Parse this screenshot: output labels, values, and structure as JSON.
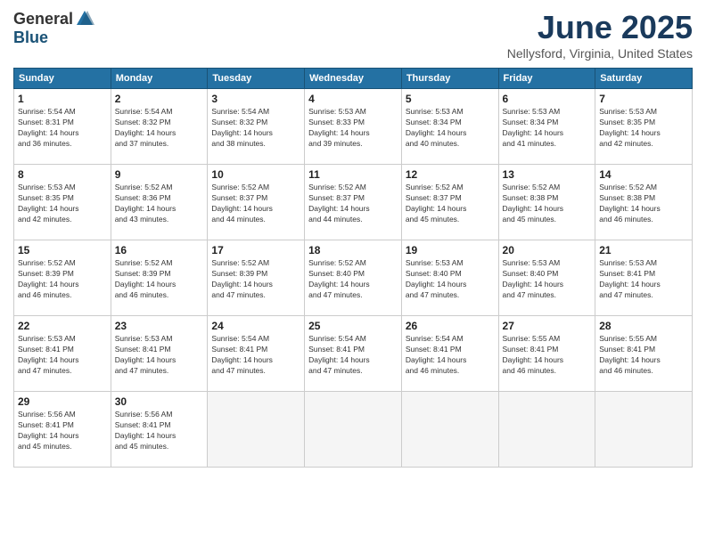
{
  "logo": {
    "general": "General",
    "blue": "Blue"
  },
  "title": "June 2025",
  "location": "Nellysford, Virginia, United States",
  "days_of_week": [
    "Sunday",
    "Monday",
    "Tuesday",
    "Wednesday",
    "Thursday",
    "Friday",
    "Saturday"
  ],
  "weeks": [
    [
      {
        "day": "1",
        "sunrise": "5:54 AM",
        "sunset": "8:31 PM",
        "daylight": "14 hours and 36 minutes."
      },
      {
        "day": "2",
        "sunrise": "5:54 AM",
        "sunset": "8:32 PM",
        "daylight": "14 hours and 37 minutes."
      },
      {
        "day": "3",
        "sunrise": "5:54 AM",
        "sunset": "8:32 PM",
        "daylight": "14 hours and 38 minutes."
      },
      {
        "day": "4",
        "sunrise": "5:53 AM",
        "sunset": "8:33 PM",
        "daylight": "14 hours and 39 minutes."
      },
      {
        "day": "5",
        "sunrise": "5:53 AM",
        "sunset": "8:34 PM",
        "daylight": "14 hours and 40 minutes."
      },
      {
        "day": "6",
        "sunrise": "5:53 AM",
        "sunset": "8:34 PM",
        "daylight": "14 hours and 41 minutes."
      },
      {
        "day": "7",
        "sunrise": "5:53 AM",
        "sunset": "8:35 PM",
        "daylight": "14 hours and 42 minutes."
      }
    ],
    [
      {
        "day": "8",
        "sunrise": "5:53 AM",
        "sunset": "8:35 PM",
        "daylight": "14 hours and 42 minutes."
      },
      {
        "day": "9",
        "sunrise": "5:52 AM",
        "sunset": "8:36 PM",
        "daylight": "14 hours and 43 minutes."
      },
      {
        "day": "10",
        "sunrise": "5:52 AM",
        "sunset": "8:37 PM",
        "daylight": "14 hours and 44 minutes."
      },
      {
        "day": "11",
        "sunrise": "5:52 AM",
        "sunset": "8:37 PM",
        "daylight": "14 hours and 44 minutes."
      },
      {
        "day": "12",
        "sunrise": "5:52 AM",
        "sunset": "8:37 PM",
        "daylight": "14 hours and 45 minutes."
      },
      {
        "day": "13",
        "sunrise": "5:52 AM",
        "sunset": "8:38 PM",
        "daylight": "14 hours and 45 minutes."
      },
      {
        "day": "14",
        "sunrise": "5:52 AM",
        "sunset": "8:38 PM",
        "daylight": "14 hours and 46 minutes."
      }
    ],
    [
      {
        "day": "15",
        "sunrise": "5:52 AM",
        "sunset": "8:39 PM",
        "daylight": "14 hours and 46 minutes."
      },
      {
        "day": "16",
        "sunrise": "5:52 AM",
        "sunset": "8:39 PM",
        "daylight": "14 hours and 46 minutes."
      },
      {
        "day": "17",
        "sunrise": "5:52 AM",
        "sunset": "8:39 PM",
        "daylight": "14 hours and 47 minutes."
      },
      {
        "day": "18",
        "sunrise": "5:52 AM",
        "sunset": "8:40 PM",
        "daylight": "14 hours and 47 minutes."
      },
      {
        "day": "19",
        "sunrise": "5:53 AM",
        "sunset": "8:40 PM",
        "daylight": "14 hours and 47 minutes."
      },
      {
        "day": "20",
        "sunrise": "5:53 AM",
        "sunset": "8:40 PM",
        "daylight": "14 hours and 47 minutes."
      },
      {
        "day": "21",
        "sunrise": "5:53 AM",
        "sunset": "8:41 PM",
        "daylight": "14 hours and 47 minutes."
      }
    ],
    [
      {
        "day": "22",
        "sunrise": "5:53 AM",
        "sunset": "8:41 PM",
        "daylight": "14 hours and 47 minutes."
      },
      {
        "day": "23",
        "sunrise": "5:53 AM",
        "sunset": "8:41 PM",
        "daylight": "14 hours and 47 minutes."
      },
      {
        "day": "24",
        "sunrise": "5:54 AM",
        "sunset": "8:41 PM",
        "daylight": "14 hours and 47 minutes."
      },
      {
        "day": "25",
        "sunrise": "5:54 AM",
        "sunset": "8:41 PM",
        "daylight": "14 hours and 47 minutes."
      },
      {
        "day": "26",
        "sunrise": "5:54 AM",
        "sunset": "8:41 PM",
        "daylight": "14 hours and 46 minutes."
      },
      {
        "day": "27",
        "sunrise": "5:55 AM",
        "sunset": "8:41 PM",
        "daylight": "14 hours and 46 minutes."
      },
      {
        "day": "28",
        "sunrise": "5:55 AM",
        "sunset": "8:41 PM",
        "daylight": "14 hours and 46 minutes."
      }
    ],
    [
      {
        "day": "29",
        "sunrise": "5:56 AM",
        "sunset": "8:41 PM",
        "daylight": "14 hours and 45 minutes."
      },
      {
        "day": "30",
        "sunrise": "5:56 AM",
        "sunset": "8:41 PM",
        "daylight": "14 hours and 45 minutes."
      },
      null,
      null,
      null,
      null,
      null
    ]
  ],
  "labels": {
    "sunrise": "Sunrise:",
    "sunset": "Sunset:",
    "daylight": "Daylight:"
  }
}
